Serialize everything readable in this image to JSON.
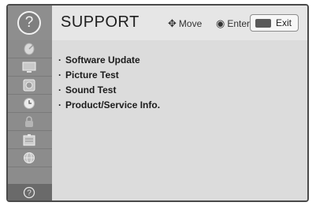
{
  "header": {
    "title": "SUPPORT",
    "hint_move": "Move",
    "hint_enter": "Enter",
    "exit_label": "Exit",
    "help_glyph": "?"
  },
  "sidebar": {
    "items": [
      {
        "icon": "satellite-dish-icon"
      },
      {
        "icon": "monitor-icon"
      },
      {
        "icon": "speaker-icon"
      },
      {
        "icon": "clock-icon"
      },
      {
        "icon": "lock-icon"
      },
      {
        "icon": "options-icon"
      },
      {
        "icon": "network-globe-icon"
      },
      {
        "icon": "support-help-icon",
        "glyph": "?"
      }
    ]
  },
  "menu": {
    "items": [
      {
        "label": "Software Update"
      },
      {
        "label": "Picture Test"
      },
      {
        "label": "Sound Test"
      },
      {
        "label": "Product/Service Info."
      }
    ]
  }
}
